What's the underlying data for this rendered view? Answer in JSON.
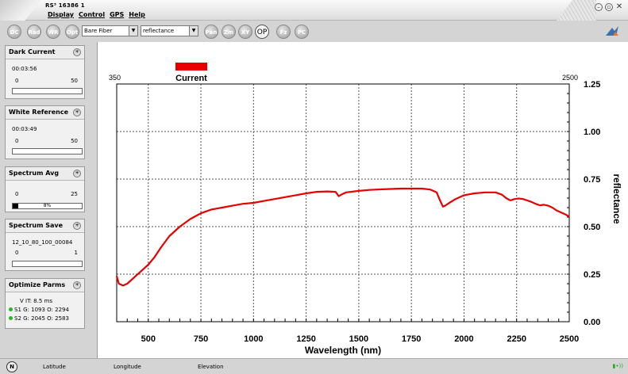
{
  "window": {
    "title": "RS³  16386 1",
    "menu": [
      "Display",
      "Control",
      "GPS",
      "Help"
    ]
  },
  "toolbar": {
    "buttons": [
      "DC",
      "Rad",
      "WR",
      "Opt"
    ],
    "fiber_select": "Bare Fiber",
    "mode_select": "reflectance",
    "view_buttons": [
      "Pan",
      "Zm",
      "XY",
      "OP",
      "Fz",
      "PC"
    ],
    "active_view": "OP"
  },
  "panels": {
    "dark_current": {
      "title": "Dark Current",
      "time": "00:03:56",
      "min": "0",
      "max": "50",
      "progress": 0
    },
    "white_reference": {
      "title": "White Reference",
      "time": "00:03:49",
      "min": "0",
      "max": "50",
      "progress": 0
    },
    "spectrum_avg": {
      "title": "Spectrum Avg",
      "min": "0",
      "max": "25",
      "progress": 0.08,
      "progress_text": "8%"
    },
    "spectrum_save": {
      "title": "Spectrum Save",
      "file": "12_10_80_100_00084",
      "min": "0",
      "max": "1",
      "progress": 0
    },
    "optimize_parms": {
      "title": "Optimize Parms",
      "vit": "V IT: 8.5 ms",
      "s1": "S1 G: 1093 O: 2294",
      "s2": "S2 G: 2045 O: 2583"
    }
  },
  "chart_data": {
    "type": "line",
    "legend": "Current",
    "legend_color": "#e60000",
    "line_color": "#e60000",
    "xlabel": "Wavelength (nm)",
    "ylabel": "reflectance",
    "x_range_left_label": "350",
    "x_range_right_label": "2500",
    "xlim": [
      350,
      2500
    ],
    "ylim": [
      0,
      1.25
    ],
    "x_ticks": [
      500,
      750,
      1000,
      1250,
      1500,
      1750,
      2000,
      2250,
      2500
    ],
    "y_ticks": [
      0.0,
      0.25,
      0.5,
      0.75,
      1.0,
      1.25
    ],
    "y_tick_labels": [
      "0.00",
      "0.25",
      "0.50",
      "0.75",
      "1.00",
      "1.25"
    ],
    "grid": true,
    "x": [
      350,
      360,
      380,
      400,
      430,
      460,
      480,
      500,
      530,
      560,
      600,
      650,
      700,
      750,
      800,
      850,
      900,
      950,
      1000,
      1050,
      1100,
      1150,
      1200,
      1250,
      1300,
      1350,
      1390,
      1405,
      1420,
      1440,
      1500,
      1550,
      1600,
      1650,
      1700,
      1750,
      1800,
      1840,
      1870,
      1885,
      1900,
      1910,
      1930,
      1960,
      2000,
      2050,
      2100,
      2150,
      2180,
      2200,
      2220,
      2240,
      2260,
      2280,
      2300,
      2320,
      2340,
      2360,
      2380,
      2400,
      2420,
      2440,
      2460,
      2480,
      2500
    ],
    "y": [
      0.24,
      0.2,
      0.19,
      0.2,
      0.23,
      0.26,
      0.28,
      0.3,
      0.34,
      0.39,
      0.45,
      0.5,
      0.54,
      0.57,
      0.59,
      0.6,
      0.61,
      0.62,
      0.625,
      0.635,
      0.645,
      0.655,
      0.665,
      0.675,
      0.683,
      0.685,
      0.683,
      0.66,
      0.67,
      0.68,
      0.688,
      0.693,
      0.696,
      0.698,
      0.7,
      0.7,
      0.7,
      0.695,
      0.68,
      0.64,
      0.605,
      0.61,
      0.625,
      0.645,
      0.665,
      0.675,
      0.68,
      0.68,
      0.668,
      0.65,
      0.638,
      0.645,
      0.648,
      0.645,
      0.638,
      0.63,
      0.62,
      0.612,
      0.615,
      0.61,
      0.6,
      0.585,
      0.575,
      0.565,
      0.553
    ]
  },
  "status": {
    "latitude": "Latitude",
    "longitude": "Longitude",
    "elevation": "Elevation"
  }
}
